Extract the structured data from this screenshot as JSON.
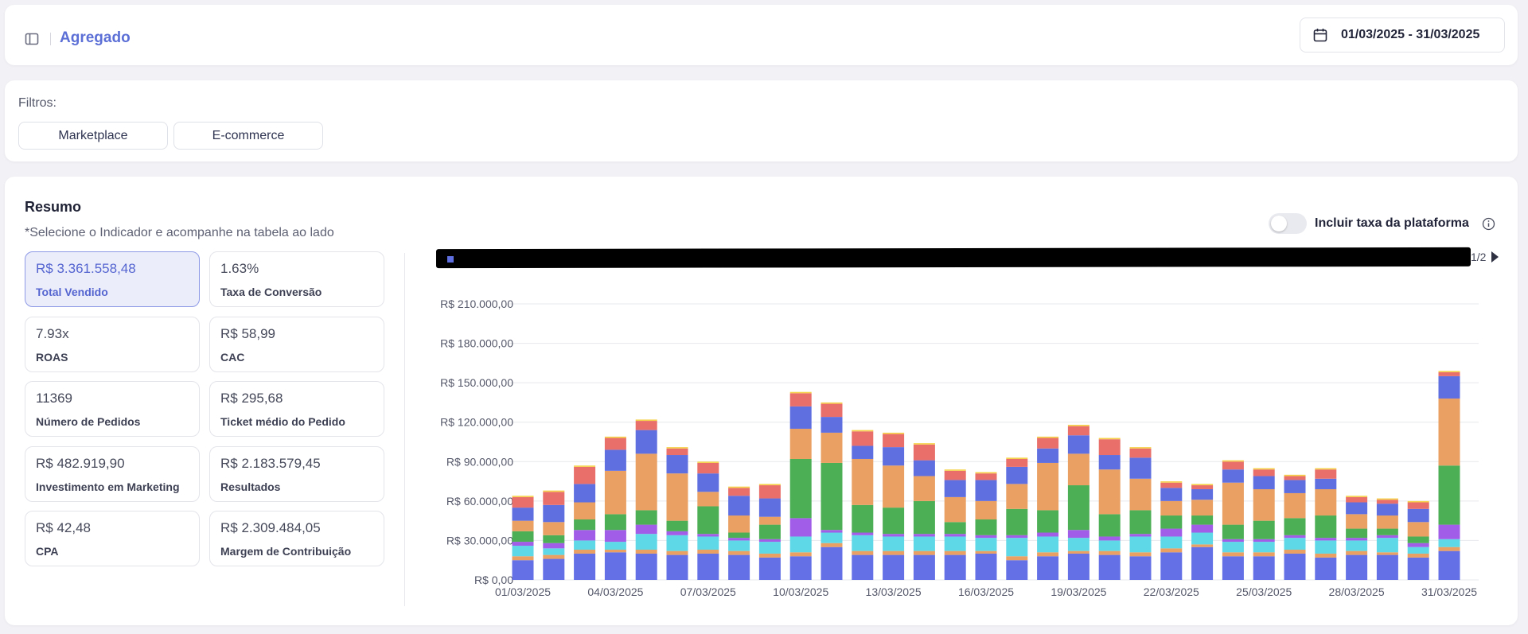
{
  "header": {
    "title": "Agregado",
    "date_range": "01/03/2025 - 31/03/2025"
  },
  "filters": {
    "label": "Filtros:",
    "options": [
      "Marketplace",
      "E-commerce"
    ]
  },
  "summary": {
    "title": "Resumo",
    "subtitle": "*Selecione o Indicador e acompanhe na tabela ao lado",
    "metrics": [
      {
        "value": "R$ 3.361.558,48",
        "label": "Total Vendido",
        "active": true
      },
      {
        "value": "1.63%",
        "label": "Taxa de Conversão"
      },
      {
        "value": "7.93x",
        "label": "ROAS"
      },
      {
        "value": "R$ 58,99",
        "label": "CAC"
      },
      {
        "value": "11369",
        "label": "Número de Pedidos"
      },
      {
        "value": "R$ 295,68",
        "label": "Ticket médio do Pedido"
      },
      {
        "value": "R$ 482.919,90",
        "label": "Investimento em Marketing"
      },
      {
        "value": "R$ 2.183.579,45",
        "label": "Resultados"
      },
      {
        "value": "R$ 42,48",
        "label": "CPA"
      },
      {
        "value": "R$ 2.309.484,05",
        "label": "Margem de Contribuição"
      }
    ],
    "toggle_label": "Incluir taxa da plataforma",
    "toggle_on": false,
    "legend_page": "1/2"
  },
  "icons": {
    "sidebar": "sidebar-toggle-icon",
    "calendar": "calendar-icon",
    "info": "info-icon",
    "next": "next-page-arrow-icon"
  },
  "chart_data": {
    "type": "bar",
    "stacked": true,
    "yticks": [
      "R$ 0,00",
      "R$ 30.000,00",
      "R$ 60.000,00",
      "R$ 90.000,00",
      "R$ 120.000,00",
      "R$ 150.000,00",
      "R$ 180.000,00",
      "R$ 210.000,00"
    ],
    "ylim": [
      0,
      210000
    ],
    "xtick_labels": [
      "01/03/2025",
      "04/03/2025",
      "07/03/2025",
      "10/03/2025",
      "13/03/2025",
      "16/03/2025",
      "19/03/2025",
      "22/03/2025",
      "25/03/2025",
      "28/03/2025",
      "31/03/2025"
    ],
    "x": [
      "01/03/2025",
      "02/03/2025",
      "03/03/2025",
      "04/03/2025",
      "05/03/2025",
      "06/03/2025",
      "07/03/2025",
      "08/03/2025",
      "09/03/2025",
      "10/03/2025",
      "11/03/2025",
      "12/03/2025",
      "13/03/2025",
      "14/03/2025",
      "15/03/2025",
      "16/03/2025",
      "17/03/2025",
      "18/03/2025",
      "19/03/2025",
      "20/03/2025",
      "21/03/2025",
      "22/03/2025",
      "23/03/2025",
      "24/03/2025",
      "25/03/2025",
      "26/03/2025",
      "27/03/2025",
      "28/03/2025",
      "29/03/2025",
      "30/03/2025",
      "31/03/2025"
    ],
    "series_colors": [
      "#6370e6",
      "#e9a062",
      "#5ed7e6",
      "#a25de8",
      "#4cae55",
      "#e9a062",
      "#5f6fe0",
      "#e96f6a",
      "#f5d24a"
    ],
    "series": [
      {
        "values": [
          15000,
          16000,
          20000,
          21000,
          20000,
          19000,
          20000,
          19000,
          17000,
          18000,
          25000,
          19000,
          19000,
          19000,
          19000,
          20000,
          15000,
          18000,
          20000,
          19000,
          18000,
          21000,
          25000,
          18000,
          18000,
          20000,
          17000,
          19000,
          19000,
          17000,
          22000
        ]
      },
      {
        "values": [
          3000,
          3000,
          3000,
          2000,
          3000,
          3000,
          3000,
          3000,
          3000,
          3000,
          3000,
          3000,
          3000,
          3000,
          3000,
          2000,
          3000,
          3000,
          2000,
          3000,
          3000,
          3000,
          2000,
          3000,
          3000,
          3000,
          3000,
          3000,
          2000,
          3000,
          3000
        ]
      },
      {
        "values": [
          8000,
          5000,
          7000,
          6000,
          12000,
          12000,
          10000,
          8000,
          9000,
          12000,
          8000,
          12000,
          11000,
          11000,
          11000,
          10000,
          14000,
          12000,
          10000,
          8000,
          12000,
          9000,
          9000,
          8000,
          8000,
          9000,
          10000,
          8000,
          11000,
          5000,
          6000
        ]
      },
      {
        "values": [
          3000,
          4000,
          8000,
          9000,
          7000,
          3000,
          2000,
          2000,
          2000,
          14000,
          2000,
          2000,
          2000,
          2000,
          2000,
          2000,
          2000,
          3000,
          6000,
          3000,
          2000,
          6000,
          6000,
          2000,
          2000,
          2000,
          2000,
          2000,
          2000,
          3000,
          11000
        ]
      },
      {
        "values": [
          8000,
          6000,
          8000,
          12000,
          11000,
          8000,
          21000,
          4000,
          11000,
          45000,
          51000,
          21000,
          20000,
          25000,
          9000,
          12000,
          20000,
          17000,
          34000,
          17000,
          18000,
          10000,
          7000,
          11000,
          14000,
          13000,
          17000,
          7000,
          5000,
          5000,
          45000
        ]
      },
      {
        "values": [
          8000,
          10000,
          13000,
          33000,
          43000,
          36000,
          11000,
          13000,
          6000,
          23000,
          23000,
          35000,
          32000,
          19000,
          19000,
          14000,
          19000,
          36000,
          24000,
          34000,
          24000,
          11000,
          12000,
          32000,
          24000,
          19000,
          20000,
          11000,
          10000,
          11000,
          51000
        ]
      },
      {
        "values": [
          10000,
          13000,
          14000,
          16000,
          18000,
          14000,
          14000,
          15000,
          14000,
          17000,
          12000,
          10000,
          14000,
          12000,
          13000,
          16000,
          13000,
          11000,
          14000,
          11000,
          16000,
          10000,
          8000,
          10000,
          10000,
          10000,
          8000,
          9000,
          9000,
          10000,
          17000
        ]
      },
      {
        "values": [
          8000,
          10000,
          13000,
          9000,
          7000,
          5000,
          8000,
          6000,
          10000,
          10000,
          10000,
          11000,
          10000,
          12000,
          7000,
          5000,
          6000,
          8000,
          7000,
          12000,
          7000,
          4000,
          3000,
          6000,
          5000,
          3000,
          7000,
          4000,
          3000,
          5000,
          3000
        ]
      },
      {
        "values": [
          1000,
          1000,
          1000,
          1000,
          1000,
          1000,
          1000,
          1000,
          1000,
          1000,
          1000,
          1000,
          1000,
          1000,
          1000,
          1000,
          1000,
          1000,
          1000,
          1000,
          1000,
          1000,
          1000,
          1000,
          1000,
          1000,
          1000,
          1000,
          1000,
          1000,
          1000
        ]
      }
    ]
  }
}
